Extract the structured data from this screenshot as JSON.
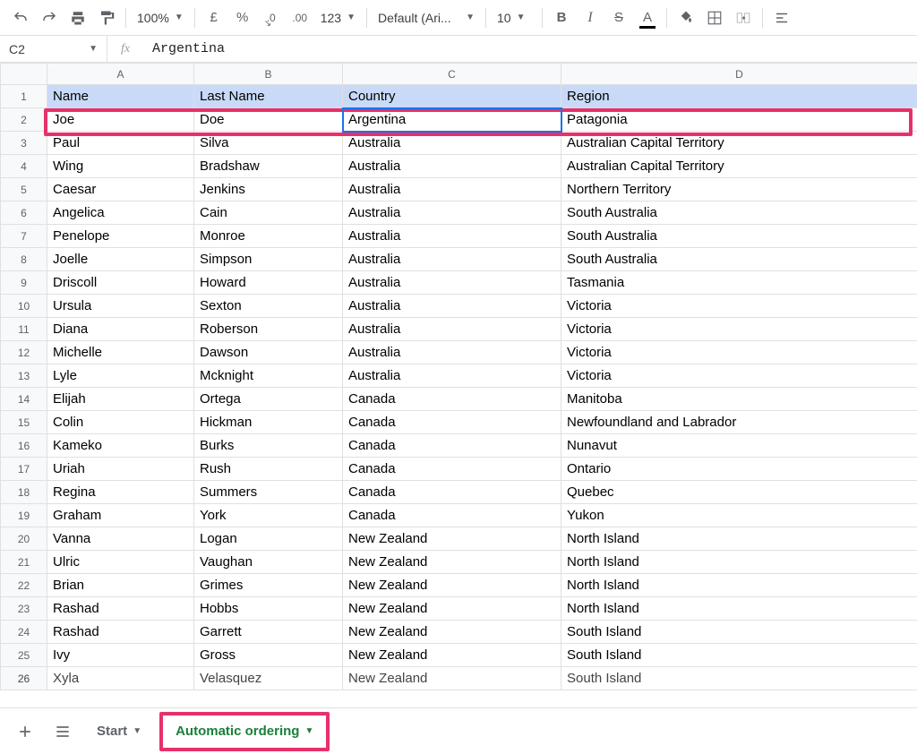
{
  "toolbar": {
    "zoom": "100%",
    "currency_symbol": "£",
    "percent_symbol": "%",
    "decrease_decimal": ".0",
    "increase_decimal": ".00",
    "more_formats": "123",
    "font_name": "Default (Ari...",
    "font_size": "10"
  },
  "namebox": "C2",
  "fx_label": "fx",
  "formula_value": "Argentina",
  "columns": [
    "A",
    "B",
    "C",
    "D"
  ],
  "header_row": {
    "name": "Name",
    "last_name": "Last Name",
    "country": "Country",
    "region": "Region"
  },
  "rows": [
    {
      "n": "2",
      "name": "Joe",
      "last": "Doe",
      "country": "Argentina",
      "region": "Patagonia"
    },
    {
      "n": "3",
      "name": "Paul",
      "last": "Silva",
      "country": "Australia",
      "region": "Australian Capital Territory"
    },
    {
      "n": "4",
      "name": "Wing",
      "last": "Bradshaw",
      "country": "Australia",
      "region": "Australian Capital Territory"
    },
    {
      "n": "5",
      "name": "Caesar",
      "last": "Jenkins",
      "country": "Australia",
      "region": "Northern Territory"
    },
    {
      "n": "6",
      "name": "Angelica",
      "last": "Cain",
      "country": "Australia",
      "region": "South Australia"
    },
    {
      "n": "7",
      "name": "Penelope",
      "last": "Monroe",
      "country": "Australia",
      "region": "South Australia"
    },
    {
      "n": "8",
      "name": "Joelle",
      "last": "Simpson",
      "country": "Australia",
      "region": "South Australia"
    },
    {
      "n": "9",
      "name": "Driscoll",
      "last": "Howard",
      "country": "Australia",
      "region": "Tasmania"
    },
    {
      "n": "10",
      "name": "Ursula",
      "last": "Sexton",
      "country": "Australia",
      "region": "Victoria"
    },
    {
      "n": "11",
      "name": "Diana",
      "last": "Roberson",
      "country": "Australia",
      "region": "Victoria"
    },
    {
      "n": "12",
      "name": "Michelle",
      "last": "Dawson",
      "country": "Australia",
      "region": "Victoria"
    },
    {
      "n": "13",
      "name": "Lyle",
      "last": "Mcknight",
      "country": "Australia",
      "region": "Victoria"
    },
    {
      "n": "14",
      "name": "Elijah",
      "last": "Ortega",
      "country": "Canada",
      "region": "Manitoba"
    },
    {
      "n": "15",
      "name": "Colin",
      "last": "Hickman",
      "country": "Canada",
      "region": "Newfoundland and Labrador"
    },
    {
      "n": "16",
      "name": "Kameko",
      "last": "Burks",
      "country": "Canada",
      "region": "Nunavut"
    },
    {
      "n": "17",
      "name": "Uriah",
      "last": "Rush",
      "country": "Canada",
      "region": "Ontario"
    },
    {
      "n": "18",
      "name": "Regina",
      "last": "Summers",
      "country": "Canada",
      "region": "Quebec"
    },
    {
      "n": "19",
      "name": "Graham",
      "last": "York",
      "country": "Canada",
      "region": "Yukon"
    },
    {
      "n": "20",
      "name": "Vanna",
      "last": "Logan",
      "country": "New Zealand",
      "region": "North Island"
    },
    {
      "n": "21",
      "name": "Ulric",
      "last": "Vaughan",
      "country": "New Zealand",
      "region": "North Island"
    },
    {
      "n": "22",
      "name": "Brian",
      "last": "Grimes",
      "country": "New Zealand",
      "region": "North Island"
    },
    {
      "n": "23",
      "name": "Rashad",
      "last": "Hobbs",
      "country": "New Zealand",
      "region": "North Island"
    },
    {
      "n": "24",
      "name": "Rashad",
      "last": "Garrett",
      "country": "New Zealand",
      "region": "South Island"
    },
    {
      "n": "25",
      "name": "Ivy",
      "last": "Gross",
      "country": "New Zealand",
      "region": "South Island"
    },
    {
      "n": "26",
      "name": "Xyla",
      "last": "Velasquez",
      "country": "New Zealand",
      "region": "South Island"
    }
  ],
  "sheet_tabs": {
    "start": "Start",
    "automatic": "Automatic ordering"
  }
}
